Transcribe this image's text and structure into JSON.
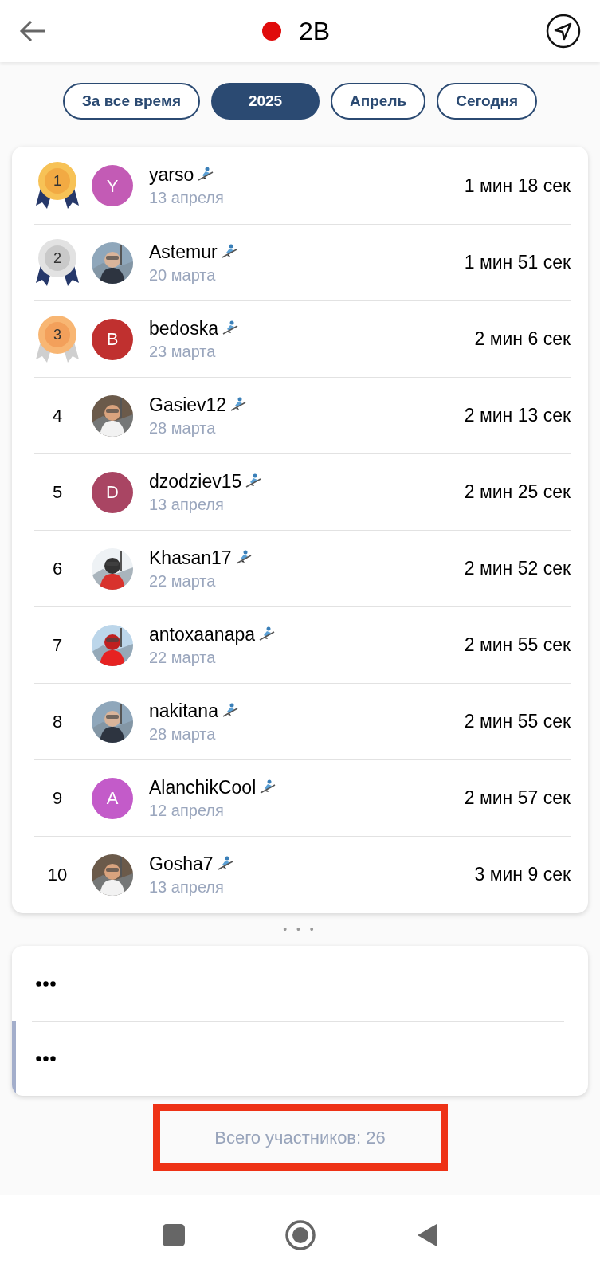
{
  "header": {
    "title": "2B",
    "color": "#e00b0b"
  },
  "periods": [
    {
      "label": "За все время",
      "selected": false
    },
    {
      "label": "2025",
      "selected": true
    },
    {
      "label": "Апрель",
      "selected": false
    },
    {
      "label": "Сегодня",
      "selected": false
    }
  ],
  "leaders": [
    {
      "rank": "1",
      "kind": "gold",
      "avatar": {
        "kind": "letter",
        "letter": "Y",
        "color": "#c35bb5"
      },
      "name": "yarso",
      "date": "13 апреля",
      "time": "1 мин 18 сек"
    },
    {
      "rank": "2",
      "kind": "silver",
      "name": "Astemur",
      "date": "20 марта",
      "time": "1 мин 51 сек"
    },
    {
      "rank": "3",
      "kind": "bronze",
      "avatar": {
        "kind": "letter",
        "letter": "B",
        "color": "#c0302f"
      },
      "name": "bedoska",
      "date": "23 марта",
      "time": "2 мин 6 сек"
    },
    {
      "rank": "4",
      "kind": "plain",
      "name": "Gasiev12",
      "date": "28 марта",
      "time": "2 мин 13 сек"
    },
    {
      "rank": "5",
      "kind": "plain",
      "avatar": {
        "kind": "letter",
        "letter": "D",
        "color": "#a94563"
      },
      "name": "dzodziev15",
      "date": "13 апреля",
      "time": "2 мин 25 сек"
    },
    {
      "rank": "6",
      "kind": "plain",
      "name": "Khasan17",
      "date": "22 марта",
      "time": "2 мин 52 сек"
    },
    {
      "rank": "7",
      "kind": "plain",
      "name": "antoxaanapa",
      "date": "22 марта",
      "time": "2 мин 55 сек"
    },
    {
      "rank": "8",
      "kind": "plain",
      "name": "nakitana",
      "date": "28 марта",
      "time": "2 мин 55 сек"
    },
    {
      "rank": "9",
      "kind": "plain",
      "avatar": {
        "kind": "letter",
        "letter": "A",
        "color": "#c35bc9"
      },
      "name": "AlanchikCool",
      "date": "12 апреля",
      "time": "2 мин 57 сек"
    },
    {
      "rank": "10",
      "kind": "plain",
      "name": "Gosha7",
      "date": "13 апреля",
      "time": "3 мин 9 сек"
    }
  ],
  "more_marker": "• • •",
  "hidden_rows": [
    {
      "highlighted": false
    },
    {
      "highlighted": true
    }
  ],
  "total": {
    "text": "Всего участников: 26",
    "annotated": true
  }
}
